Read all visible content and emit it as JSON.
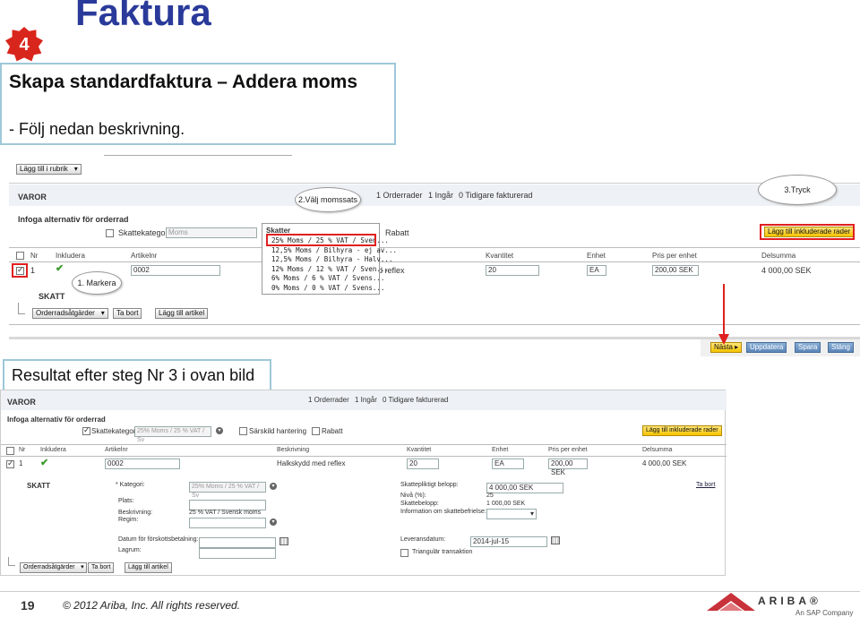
{
  "slide": {
    "title": "Faktura",
    "step_number": "4",
    "heading": "Skapa standardfaktura – Addera moms",
    "instruction": "-     Följ nedan beskrivning.",
    "result_title": "Resultat efter steg Nr 3 i ovan bild",
    "page_number": "19",
    "copyright": "© 2012 Ariba, Inc. All rights reserved.",
    "logo": "ARIBA®",
    "logo_sub": "An SAP Company"
  },
  "callouts": {
    "step1": "1. Markera",
    "step2": "2.Välj momssats",
    "step3": "3.Tryck"
  },
  "top": {
    "add_header_btn": "Lägg till i rubrik",
    "section_label": "VAROR",
    "summary": [
      "1 Orderrader",
      "1 Ingår",
      "0 Tidigare fakturerad"
    ],
    "options_heading": "Infoga alternativ för orderrad",
    "tax_category_label": "Skattekategori:",
    "tax_category_placeholder": "Moms",
    "discount_label": "Rabatt",
    "add_included_btn": "Lägg till inkluderade rader",
    "columns": [
      "Nr",
      "Inkludera",
      "Artikelnr",
      "Kvantitet",
      "Enhet",
      "Pris per enhet",
      "Delsumma"
    ],
    "row": {
      "nr": "1",
      "article": "0002",
      "desc_partial": "d reflex",
      "qty": "20",
      "unit": "EA",
      "price": "200,00 SEK",
      "subtotal": "4 000,00 SEK"
    },
    "tax_label": "SKATT",
    "actions_btn": "Orderradsåtgärder",
    "remove_btn": "Ta bort",
    "add_article_btn": "Lägg till artikel",
    "nav_buttons": [
      "Nästa",
      "Uppdatera",
      "Spara",
      "Stäng"
    ]
  },
  "tax_dropdown": {
    "header": "Skatter",
    "options": [
      "25% Moms / 25 % VAT / Sven...",
      "12,5% Moms / Bilhyra - ej av...",
      "12,5% Moms / Bilhyra - Halv...",
      "12% Moms / 12 % VAT / Sven...",
      "6% Moms / 6 % VAT / Svens...",
      "0% Moms / 0 % VAT / Svens..."
    ]
  },
  "bottom": {
    "section_label": "VAROR",
    "summary": [
      "1 Orderrader",
      "1 Ingår",
      "0 Tidigare fakturerad"
    ],
    "options_heading": "Infoga alternativ för orderrad",
    "tax_category_label": "Skattekategori:",
    "tax_category_value": "25% Moms / 25 % VAT / Sv",
    "special_handling_label": "Särskild hantering",
    "discount_label": "Rabatt",
    "add_included_btn": "Lägg till inkluderade rader",
    "columns": [
      "Nr",
      "Inkludera",
      "Artikelnr",
      "Beskrivning",
      "Kvantitet",
      "Enhet",
      "Pris per enhet",
      "Delsumma"
    ],
    "row": {
      "nr": "1",
      "article": "0002",
      "desc": "Halkskydd med reflex",
      "qty": "20",
      "unit": "EA",
      "price": "200,00 SEK",
      "subtotal": "4 000,00 SEK"
    },
    "tax_label": "SKATT",
    "category_label": "* Kategori:",
    "category_value": "25% Moms / 25 % VAT / Sv",
    "place_label": "Plats:",
    "description_label": "Beskrivning:",
    "description_value": "25 % VAT / Svensk moms",
    "regime_label": "Regim:",
    "taxable_amount_label": "Skattepliktigt belopp:",
    "taxable_amount_value": "4 000,00 SEK",
    "level_label": "Nivå (%):",
    "level_value": "25",
    "tax_amount_label": "Skattebelopp:",
    "tax_amount_value": "1 000,00 SEK",
    "exemption_label": "Information om skattebefrielse:",
    "remove_link": "Ta bort",
    "prepay_label": "Datum för förskottsbetalning:",
    "delivery_label": "Leveransdatum:",
    "delivery_value": "2014-jul-15",
    "ledger_label": "Lagrum:",
    "triangular_label": "Triangulär transaktion",
    "actions_btn": "Orderradsåtgärder",
    "remove_btn": "Ta bort",
    "add_article_btn": "Lägg till artikel"
  }
}
